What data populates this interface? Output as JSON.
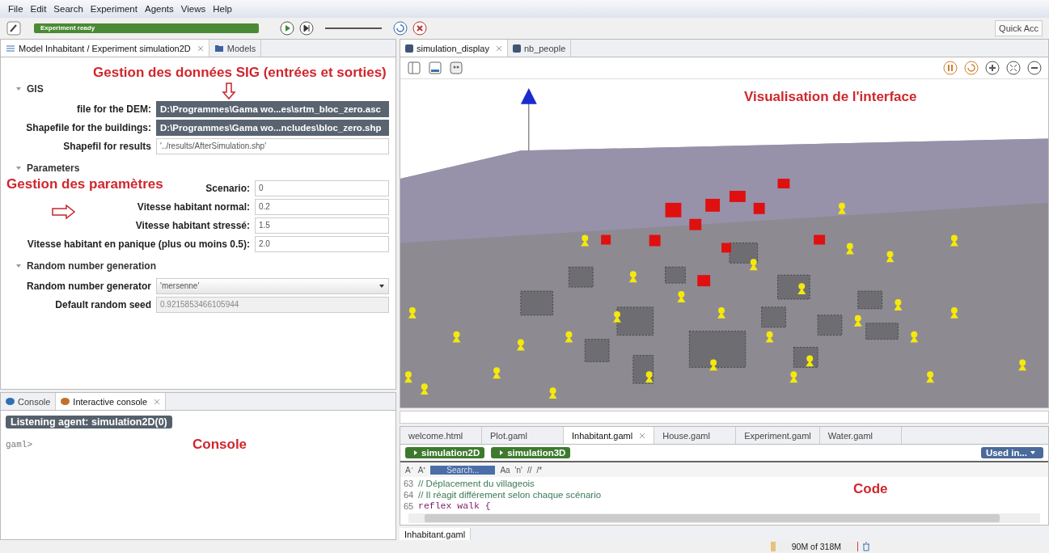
{
  "menu": [
    "File",
    "Edit",
    "Search",
    "Experiment",
    "Agents",
    "Views",
    "Help"
  ],
  "toolbar": {
    "status": "Experiment ready",
    "speed": {
      "level": 1.0
    },
    "quick_access": "Quick Acc"
  },
  "left_tabs": [
    {
      "label": "Model Inhabitant / Experiment simulation2D",
      "selected": true,
      "closable": true,
      "kind": "params"
    },
    {
      "label": "Models",
      "selected": false,
      "closable": false,
      "kind": "folder"
    }
  ],
  "sections": [
    {
      "title": "GIS",
      "expanded": true,
      "params": [
        {
          "label": "file for the DEM:",
          "value": "D:\\Programmes\\Gama wo...es\\srtm_bloc_zero.asc",
          "kind": "path"
        },
        {
          "label": "Shapefile for the buildings:",
          "value": "D:\\Programmes\\Gama wo...ncludes\\bloc_zero.shp",
          "kind": "path"
        },
        {
          "label": "Shapefil for results",
          "value": "'../results/AfterSimulation.shp'",
          "kind": "text"
        }
      ]
    },
    {
      "title": "Parameters",
      "expanded": true,
      "params": [
        {
          "label": "Scenario:",
          "value": "0",
          "kind": "text"
        },
        {
          "label": "Vitesse habitant normal:",
          "value": "0.2",
          "kind": "text"
        },
        {
          "label": "Vitesse habitant stressé:",
          "value": "1.5",
          "kind": "text"
        },
        {
          "label": "Vitesse habitant en panique (plus ou moins 0.5):",
          "value": "2.0",
          "kind": "text"
        }
      ]
    },
    {
      "title": "Random number generation",
      "expanded": true,
      "params": [
        {
          "label": "Random number generator",
          "value": "'mersenne'",
          "kind": "dropdown"
        },
        {
          "label": "Default random seed",
          "value": "0.9215853466105944",
          "kind": "readonly"
        }
      ]
    }
  ],
  "console_tabs": [
    {
      "label": "Console",
      "selected": false,
      "closable": false,
      "color": "#2f6fb5"
    },
    {
      "label": "Interactive console",
      "selected": true,
      "closable": true,
      "color": "#c0702a"
    }
  ],
  "console": {
    "agent": "Listening agent: simulation2D(0)",
    "prompt": "gaml>"
  },
  "display_tabs": [
    {
      "label": "simulation_display",
      "selected": true,
      "closable": true
    },
    {
      "label": "nb_people",
      "selected": false,
      "closable": false
    }
  ],
  "editor_tabs": [
    {
      "label": "welcome.html",
      "selected": false,
      "closable": false
    },
    {
      "label": "Plot.gaml",
      "selected": false,
      "closable": false
    },
    {
      "label": "Inhabitant.gaml",
      "selected": true,
      "closable": true
    },
    {
      "label": "House.gaml",
      "selected": false,
      "closable": false
    },
    {
      "label": "Experiment.gaml",
      "selected": false,
      "closable": false
    },
    {
      "label": "Water.gaml",
      "selected": false,
      "closable": false
    }
  ],
  "experiments": [
    "simulation2D",
    "simulation3D"
  ],
  "used_in": "Used in...",
  "editor_toolbar": {
    "search": "Search...",
    "items": [
      "A⁻",
      "A⁺",
      "Aa",
      "'n'",
      "//",
      "/*"
    ]
  },
  "code": [
    {
      "number": "63",
      "text": "// Déplacement du villageois",
      "kind": "comment"
    },
    {
      "number": "64",
      "text": "// Il réagit différement selon chaque scénario",
      "kind": "comment"
    },
    {
      "number": "65",
      "text": "reflex walk {",
      "kind": "code"
    }
  ],
  "bottom_tab": {
    "label": "Inhabitant.gaml",
    "selected": true
  },
  "status_bar": {
    "memory": "90M of 318M"
  },
  "annotations": [
    {
      "text": "Gestion des données SIG (entrées et sorties)",
      "kind": "sig"
    },
    {
      "text": "Visualisation de l'interface",
      "kind": "view"
    },
    {
      "text": "Gestion des paramètres",
      "kind": "params"
    },
    {
      "text": "Console",
      "kind": "console"
    },
    {
      "text": "Code",
      "kind": "code"
    }
  ]
}
